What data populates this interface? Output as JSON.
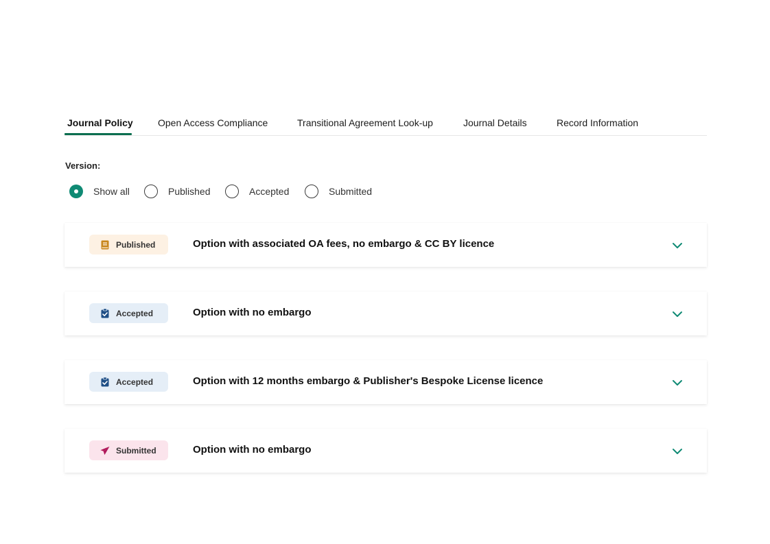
{
  "tabs": [
    {
      "label": "Journal Policy",
      "active": true
    },
    {
      "label": "Open Access Compliance",
      "active": false
    },
    {
      "label": "Transitional Agreement Look-up",
      "active": false
    },
    {
      "label": "Journal Details",
      "active": false
    },
    {
      "label": "Record Information",
      "active": false
    }
  ],
  "version_filter": {
    "label": "Version:",
    "options": [
      {
        "label": "Show all",
        "checked": true
      },
      {
        "label": "Published",
        "checked": false
      },
      {
        "label": "Accepted",
        "checked": false
      },
      {
        "label": "Submitted",
        "checked": false
      }
    ]
  },
  "policies": [
    {
      "badge": "Published",
      "badge_icon": "book-icon",
      "badge_bg": "#fdf1e3",
      "icon_color": "#c8871c",
      "title": "Option with associated OA fees, no embargo & CC BY licence"
    },
    {
      "badge": "Accepted",
      "badge_icon": "clipboard-check-icon",
      "badge_bg": "#e5eef7",
      "icon_color": "#1f4f86",
      "title": "Option with no embargo"
    },
    {
      "badge": "Accepted",
      "badge_icon": "clipboard-check-icon",
      "badge_bg": "#e5eef7",
      "icon_color": "#1f4f86",
      "title": "Option with 12 months embargo & Publisher's Bespoke License licence"
    },
    {
      "badge": "Submitted",
      "badge_icon": "paper-plane-icon",
      "badge_bg": "#fbe4ec",
      "icon_color": "#b0185a",
      "title": "Option with no embargo"
    }
  ],
  "colors": {
    "accent": "#0b6e4f",
    "radio_checked": "#0f8a74",
    "chevron": "#0f8a74"
  }
}
